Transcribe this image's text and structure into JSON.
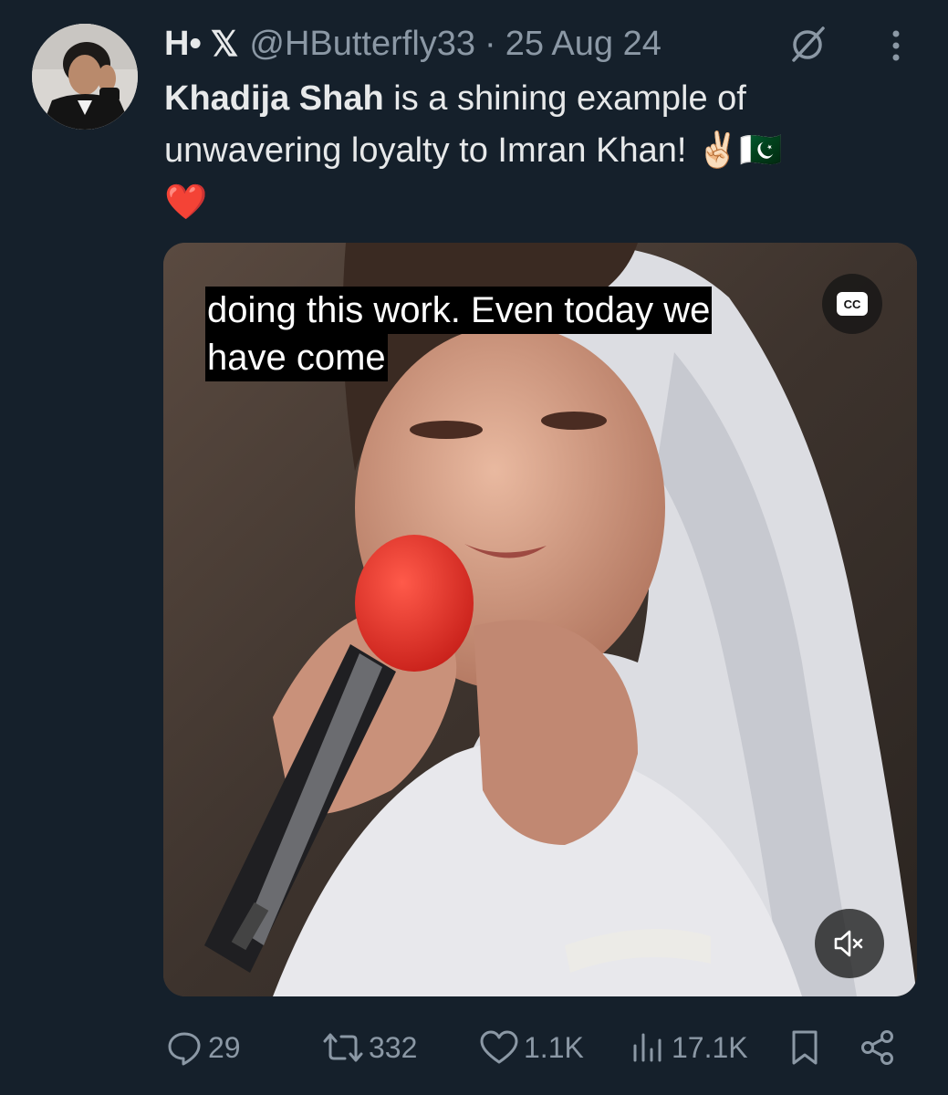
{
  "tweet": {
    "display_name": "H•",
    "verified_badge": "𝕏",
    "handle": "@HButterfly33",
    "separator": "·",
    "date": "25 Aug 24",
    "mention": "Khadija Shah",
    "body_after_mention": " is a shining example of unwavering loyalty to Imran Khan! ",
    "emojis": "✌🏻🇵🇰",
    "heart": "❤️",
    "icons": {
      "avatar": "profile-photo",
      "grok": "grok-icon",
      "more": "more-icon"
    }
  },
  "video": {
    "caption_line1": "doing this work. Even today we",
    "caption_line2": "have come",
    "cc_label": "CC",
    "muted": true
  },
  "actions": {
    "replies": "29",
    "reposts": "332",
    "likes": "1.1K",
    "views": "17.1K"
  },
  "colors": {
    "background": "#15202b",
    "text": "#e7e9ea",
    "secondary": "#8b98a5",
    "heart": "#f2203a",
    "mic": "#e0261f"
  }
}
